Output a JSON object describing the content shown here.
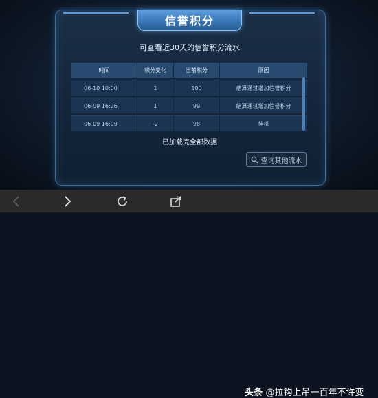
{
  "dialog": {
    "title": "信誉积分",
    "subtitle": "可查看近30天的信誉积分流水",
    "loaded_text": "已加载完全部数据",
    "query_button_label": "查询其他流水"
  },
  "table": {
    "headers": [
      "时间",
      "积分变化",
      "当前积分",
      "原因"
    ],
    "rows": [
      [
        "06-10  10:00",
        "1",
        "100",
        "结算通过增加信誉积分"
      ],
      [
        "06-09  16:26",
        "1",
        "99",
        "结算通过增加信誉积分"
      ],
      [
        "06-09  16:09",
        "-2",
        "98",
        "挂机"
      ]
    ]
  },
  "watermark": {
    "brand": "头条",
    "handle": "@拉钩上吊一百年不许变"
  },
  "icons": [
    "back-icon",
    "forward-icon",
    "refresh-icon",
    "share-icon",
    "search-icon"
  ],
  "colors": {
    "accent": "#3a78b8",
    "panel": "#13253a",
    "bottom_bar": "#2a2a2a"
  }
}
